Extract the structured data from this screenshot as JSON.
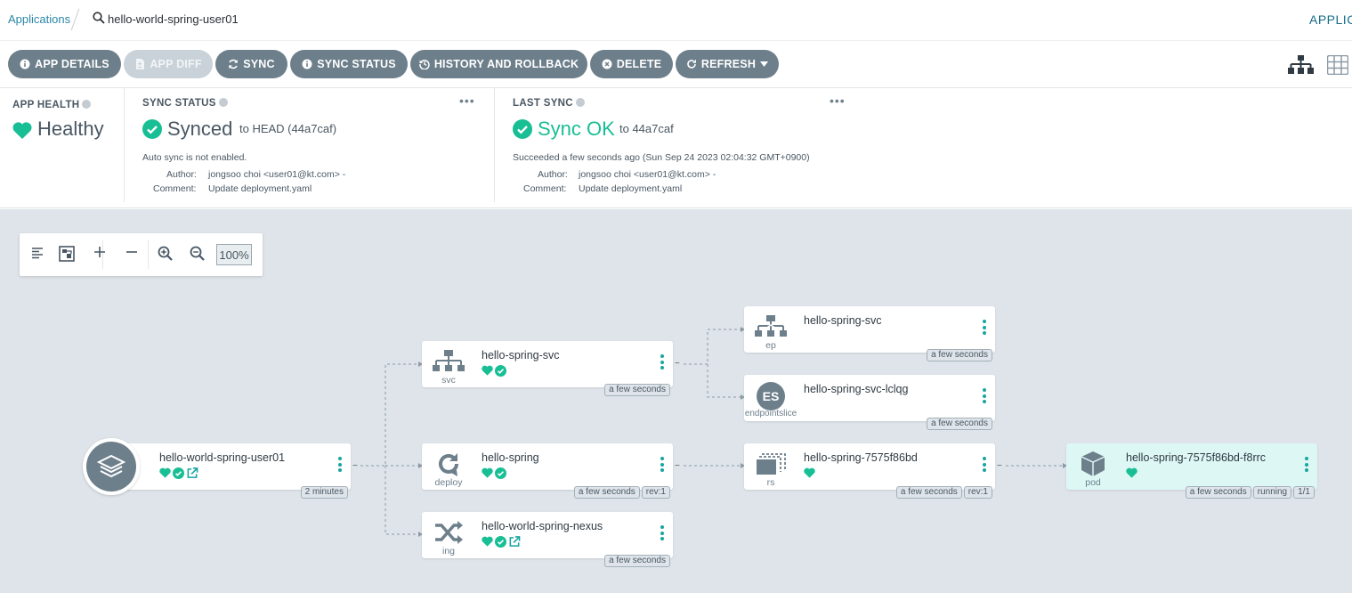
{
  "breadcrumb": {
    "root": "Applications",
    "current": "hello-world-spring-user01"
  },
  "top_right_label": "APPLIC",
  "toolbar": {
    "buttons": [
      {
        "label": "APP DETAILS",
        "icon": "info-icon",
        "enabled": true
      },
      {
        "label": "APP DIFF",
        "icon": "file-diff-icon",
        "enabled": false
      },
      {
        "label": "SYNC",
        "icon": "sync-icon",
        "enabled": true
      },
      {
        "label": "SYNC STATUS",
        "icon": "info-icon",
        "enabled": true
      },
      {
        "label": "HISTORY AND ROLLBACK",
        "icon": "history-icon",
        "enabled": true
      },
      {
        "label": "DELETE",
        "icon": "times-circle-icon",
        "enabled": true
      },
      {
        "label": "REFRESH",
        "icon": "redo-icon",
        "enabled": true
      }
    ],
    "views": [
      "tree-view-icon",
      "grid-view-icon"
    ]
  },
  "status": {
    "app_health": {
      "title": "APP HEALTH",
      "value": "Healthy"
    },
    "sync_status": {
      "title": "SYNC STATUS",
      "value": "Synced",
      "target": "to HEAD (44a7caf)",
      "auto_sync": "Auto sync is not enabled.",
      "author_label": "Author:",
      "author": "jongsoo choi <user01@kt.com> -",
      "comment_label": "Comment:",
      "comment": "Update deployment.yaml"
    },
    "last_sync": {
      "title": "LAST SYNC",
      "value": "Sync OK",
      "target": "to 44a7caf",
      "when": "Succeeded a few seconds ago (Sun Sep 24 2023 02:04:32 GMT+0900)",
      "author_label": "Author:",
      "author": "jongsoo choi <user01@kt.com> -",
      "comment_label": "Comment:",
      "comment": "Update deployment.yaml"
    }
  },
  "zoom": {
    "value": "100%"
  },
  "colors": {
    "healthy": "#18be94",
    "accent": "#18a5a0",
    "muted": "#6d7f8b"
  },
  "nodes": {
    "app": {
      "name": "hello-world-spring-user01",
      "tags": [
        "2 minutes"
      ]
    },
    "svc": {
      "kind": "svc",
      "name": "hello-spring-svc",
      "tags": [
        "a few seconds"
      ]
    },
    "deploy": {
      "kind": "deploy",
      "name": "hello-spring",
      "tags": [
        "a few seconds",
        "rev:1"
      ]
    },
    "ing": {
      "kind": "ing",
      "name": "hello-world-spring-nexus",
      "tags": [
        "a few seconds"
      ]
    },
    "ep": {
      "kind": "ep",
      "name": "hello-spring-svc",
      "tags": [
        "a few seconds"
      ]
    },
    "eps": {
      "kind": "endpointslice",
      "name": "hello-spring-svc-lclqg",
      "badge": "ES",
      "tags": [
        "a few seconds"
      ]
    },
    "rs": {
      "kind": "rs",
      "name": "hello-spring-7575f86bd",
      "tags": [
        "a few seconds",
        "rev:1"
      ]
    },
    "pod": {
      "kind": "pod",
      "name": "hello-spring-7575f86bd-f8rrc",
      "tags": [
        "a few seconds",
        "running",
        "1/1"
      ]
    }
  }
}
